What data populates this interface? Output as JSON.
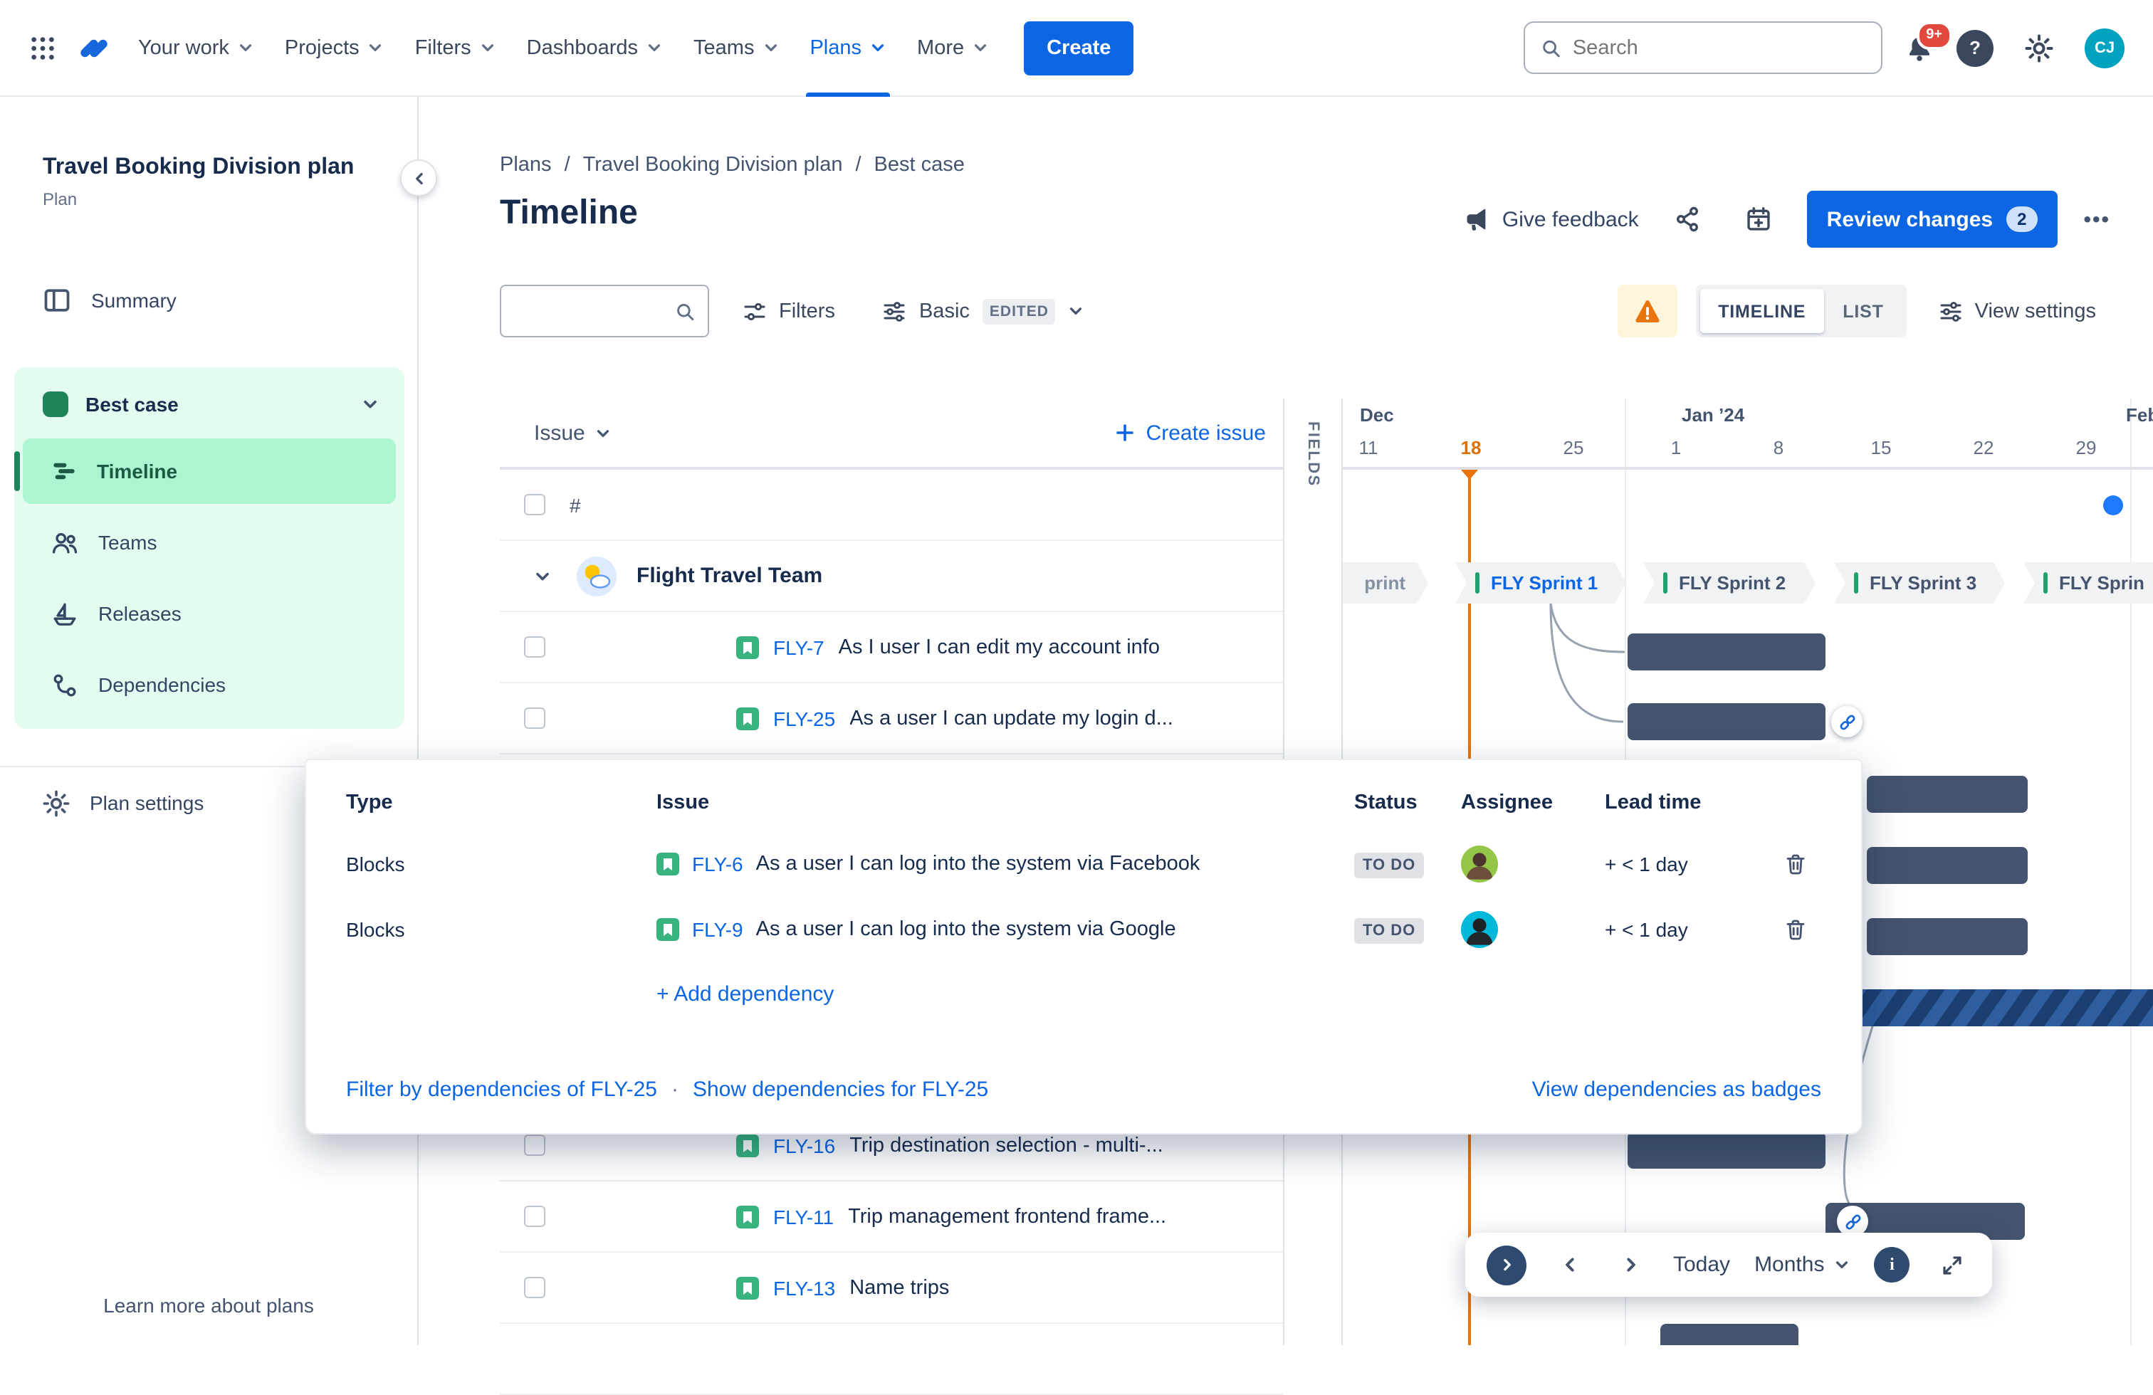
{
  "colors": {
    "accent_blue": "#0C66E4",
    "scenario_green": "#1F845A",
    "scenario_mint": "#E3FCEF",
    "today_orange": "#E8740C",
    "bar_slate": "#44546F",
    "warning_orange": "#E8740C",
    "badge_red": "#E2483D"
  },
  "topnav": {
    "items": [
      {
        "label": "Your work"
      },
      {
        "label": "Projects"
      },
      {
        "label": "Filters"
      },
      {
        "label": "Dashboards"
      },
      {
        "label": "Teams"
      },
      {
        "label": "Plans"
      },
      {
        "label": "More"
      }
    ],
    "create_label": "Create",
    "search_placeholder": "Search",
    "notification_badge": "9+",
    "help_glyph": "?",
    "avatar_initials": "CJ"
  },
  "sidebar": {
    "plan_name": "Travel Booking Division plan",
    "plan_type": "Plan",
    "summary": "Summary",
    "scenario": "Best case",
    "nav": [
      {
        "label": "Timeline"
      },
      {
        "label": "Teams"
      },
      {
        "label": "Releases"
      },
      {
        "label": "Dependencies"
      }
    ],
    "plan_settings": "Plan settings",
    "learn_more": "Learn more about plans"
  },
  "header": {
    "breadcrumb": [
      {
        "label": "Plans"
      },
      {
        "label": "Travel Booking Division plan"
      },
      {
        "label": "Best case"
      }
    ],
    "separator": "/",
    "title": "Timeline",
    "give_feedback": "Give feedback",
    "review_changes": "Review changes",
    "review_count": "2",
    "more_glyph": "•••"
  },
  "toolbar": {
    "filters": "Filters",
    "view_name": "Basic",
    "view_badge": "EDITED",
    "toggle": [
      {
        "label": "TIMELINE"
      },
      {
        "label": "LIST"
      }
    ],
    "view_settings": "View settings"
  },
  "table": {
    "issue_column": "Issue",
    "create_issue": "Create issue",
    "fields_tab": "FIELDS",
    "numbering": "#",
    "team_name": "Flight Travel Team",
    "rows": [
      {
        "key": "FLY-7",
        "summary": "As I user I can edit my account info"
      },
      {
        "key": "FLY-25",
        "summary": "As a user I can update my login d..."
      },
      {
        "key": "FLY-16",
        "summary": "Trip destination selection - multi-..."
      },
      {
        "key": "FLY-11",
        "summary": "Trip management frontend frame..."
      },
      {
        "key": "FLY-13",
        "summary": "Name trips"
      }
    ]
  },
  "timeline": {
    "months": [
      {
        "label": "Dec"
      },
      {
        "label": "Jan ’24"
      },
      {
        "label": "Feb"
      }
    ],
    "dates": [
      {
        "d": "11"
      },
      {
        "d": "18",
        "today": true
      },
      {
        "d": "25"
      },
      {
        "d": "1"
      },
      {
        "d": "8"
      },
      {
        "d": "15"
      },
      {
        "d": "22"
      },
      {
        "d": "29"
      }
    ],
    "sprints": [
      {
        "label": "print"
      },
      {
        "label": "FLY Sprint 1"
      },
      {
        "label": "FLY Sprint 2"
      },
      {
        "label": "FLY Sprint 3"
      },
      {
        "label": "FLY Sprin"
      }
    ],
    "controls": {
      "today": "Today",
      "scale": "Months",
      "info_glyph": "i"
    }
  },
  "dependency_popup": {
    "columns": [
      {
        "label": "Type"
      },
      {
        "label": "Issue"
      },
      {
        "label": "Status"
      },
      {
        "label": "Assignee"
      },
      {
        "label": "Lead time"
      }
    ],
    "rows": [
      {
        "type": "Blocks",
        "key": "FLY-6",
        "summary": "As a user I can log into the system via Facebook",
        "status": "TO DO",
        "lead_time": "+ < 1 day"
      },
      {
        "type": "Blocks",
        "key": "FLY-9",
        "summary": "As a user I can log into the system via Google",
        "status": "TO DO",
        "lead_time": "+ < 1 day"
      }
    ],
    "add_dependency": "+ Add dependency",
    "filter_by": "Filter by dependencies of FLY-25",
    "dot": "·",
    "show_for": "Show dependencies for FLY-25",
    "view_as_badges": "View dependencies as badges"
  }
}
